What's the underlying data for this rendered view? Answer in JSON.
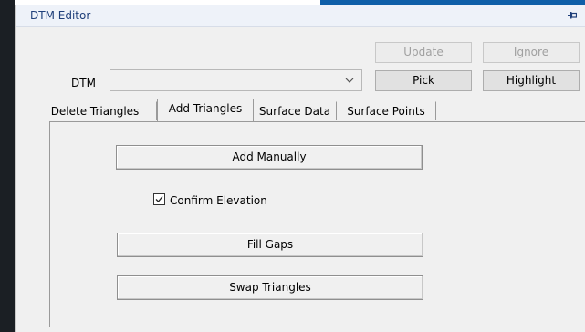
{
  "window": {
    "title": "DTM Editor"
  },
  "toolbar": {
    "update_label": "Update",
    "ignore_label": "Ignore",
    "pick_label": "Pick",
    "highlight_label": "Highlight"
  },
  "dtm": {
    "label": "DTM",
    "selected": ""
  },
  "tabs": [
    {
      "label": "Delete Triangles"
    },
    {
      "label": "Add Triangles"
    },
    {
      "label": "Surface Data"
    },
    {
      "label": "Surface Points"
    }
  ],
  "active_tab": "Add Triangles",
  "add_triangles": {
    "add_manually_label": "Add Manually",
    "confirm_elevation_label": "Confirm Elevation",
    "confirm_elevation_checked": true,
    "fill_gaps_label": "Fill Gaps",
    "swap_triangles_label": "Swap Triangles"
  },
  "icons": {
    "pin": "pin-icon",
    "dropdown": "chevron-down-icon",
    "check": "check-icon"
  },
  "colors": {
    "title_text": "#1f3f7a",
    "title_bar": "#eef2f9",
    "panel": "#f0f0f0",
    "accent": "#0f5fa8"
  }
}
